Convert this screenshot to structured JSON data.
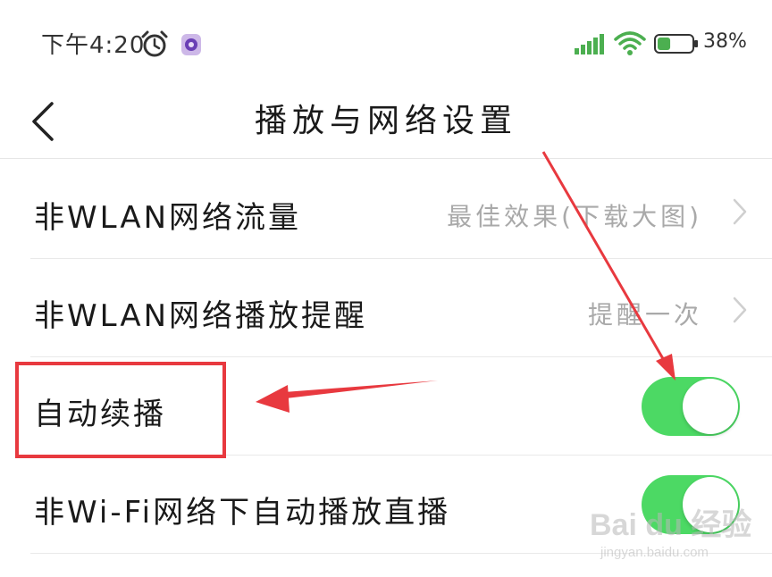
{
  "status_bar": {
    "time": "下午4:20",
    "battery_text": "38%",
    "battery_level": 0.38,
    "icons": [
      "alarm-clock-icon",
      "app-notification-icon",
      "signal-icon",
      "wifi-icon",
      "battery-icon"
    ]
  },
  "header": {
    "back_icon": "chevron-left-icon",
    "title": "播放与网络设置"
  },
  "settings": [
    {
      "label": "非WLAN网络流量",
      "value": "最佳效果(下载大图)",
      "type": "link",
      "icon": "chevron-right-icon"
    },
    {
      "label": "非WLAN网络播放提醒",
      "value": "提醒一次",
      "type": "link",
      "icon": "chevron-right-icon"
    },
    {
      "label": "自动续播",
      "type": "toggle",
      "on": true
    },
    {
      "label": "非Wi-Fi网络下自动播放直播",
      "type": "toggle",
      "on": true
    }
  ],
  "colors": {
    "toggle_on": "#4cd964",
    "annotation_red": "#e8393f",
    "value_gray": "#a9a9a9"
  },
  "watermark": {
    "brand": "Bai du 经验",
    "sub": "jingyan.baidu.com"
  }
}
